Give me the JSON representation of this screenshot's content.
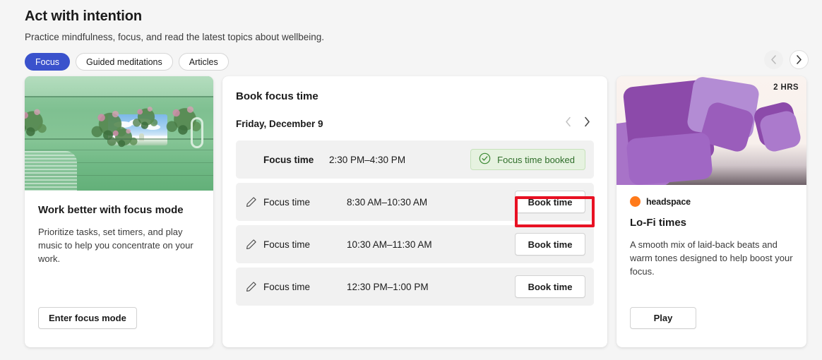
{
  "header": {
    "title": "Act with intention",
    "subtitle": "Practice mindfulness, focus, and read the latest topics about wellbeing.",
    "filters": [
      {
        "label": "Focus",
        "active": true
      },
      {
        "label": "Guided meditations",
        "active": false
      },
      {
        "label": "Articles",
        "active": false
      }
    ],
    "carousel": {
      "prev_icon": "chevron-left-icon",
      "next_icon": "chevron-right-icon",
      "prev_disabled": true
    }
  },
  "cards": {
    "focus_mode": {
      "image_alt": "green-abstract-interior-image",
      "heading": "Work better with focus mode",
      "body": "Prioritize tasks, set timers, and play music to help you concentrate on your work.",
      "button": "Enter focus mode"
    },
    "book_focus_time": {
      "title": "Book focus time",
      "date": "Friday, December 9",
      "prev_day_icon": "chevron-left-icon",
      "next_day_icon": "chevron-right-icon",
      "slots": [
        {
          "label": "Focus time",
          "time": "2:30 PM–4:30 PM",
          "state": "booked",
          "status_text": "Focus time booked",
          "status_icon": "check-circle-icon",
          "edit_icon": null,
          "highlighted": false
        },
        {
          "label": "Focus time",
          "time": "8:30 AM–10:30 AM",
          "state": "available",
          "action": "Book time",
          "edit_icon": "pencil-icon",
          "highlighted": true
        },
        {
          "label": "Focus time",
          "time": "10:30 AM–11:30 AM",
          "state": "available",
          "action": "Book time",
          "edit_icon": "pencil-icon",
          "highlighted": false
        },
        {
          "label": "Focus time",
          "time": "12:30 PM–1:00 PM",
          "state": "available",
          "action": "Book time",
          "edit_icon": "pencil-icon",
          "highlighted": false
        }
      ]
    },
    "headspace": {
      "image_alt": "purple-squares-abstract-image",
      "duration_badge": "2 HRS",
      "brand": "headspace",
      "heading": "Lo-Fi times",
      "body": "A smooth mix of laid-back beats and warm tones designed to help boost your focus.",
      "button": "Play"
    }
  },
  "colors": {
    "page_background": "#f5f5f5",
    "card_background": "#ffffff",
    "accent_blue": "#3a52cc",
    "booked_green_text": "#2f6e2a",
    "booked_green_bg": "#e6f2e0",
    "highlight_red": "#e81123",
    "brand_orange": "#ff7a1a",
    "slot_row_bg": "#f1f1f1"
  }
}
